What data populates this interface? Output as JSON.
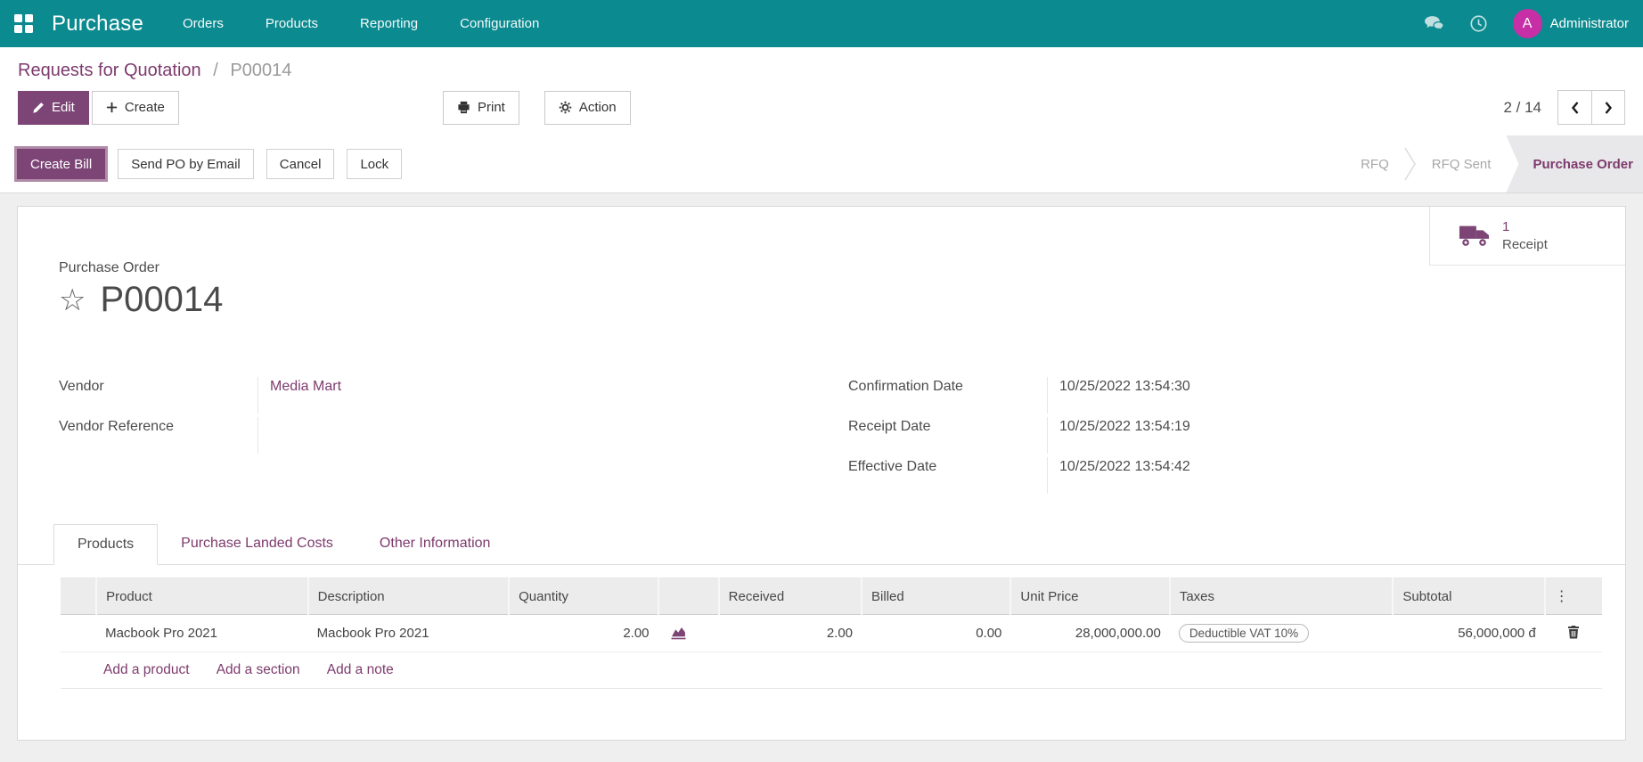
{
  "colors": {
    "navbar_teal": "#0b8a8f",
    "accent_purple": "#7c4576",
    "link_purple": "#7d3a6d",
    "avatar_magenta": "#c62fa5",
    "page_background": "#efefef",
    "state_active_background": "#e8e8ea"
  },
  "navbar": {
    "app_name": "Purchase",
    "menus": [
      {
        "label": "Orders"
      },
      {
        "label": "Products"
      },
      {
        "label": "Reporting"
      },
      {
        "label": "Configuration"
      }
    ],
    "icons": {
      "apps": "grid-icon",
      "messages": "chat-bubbles-icon",
      "activities": "clock-icon"
    },
    "avatar_initial": "A",
    "user_name": "Administrator"
  },
  "breadcrumb": {
    "parent": "Requests for Quotation",
    "separator": "/",
    "current": "P00014"
  },
  "control_panel": {
    "edit_label": "Edit",
    "create_label": "Create",
    "print_label": "Print",
    "action_label": "Action",
    "pager_value": "2 / 14"
  },
  "statusbar": {
    "buttons": [
      {
        "label": "Create Bill",
        "primary": true
      },
      {
        "label": "Send PO by Email",
        "primary": false
      },
      {
        "label": "Cancel",
        "primary": false
      },
      {
        "label": "Lock",
        "primary": false
      }
    ],
    "states": [
      {
        "label": "RFQ",
        "active": false
      },
      {
        "label": "RFQ Sent",
        "active": false
      },
      {
        "label": "Purchase Order",
        "active": true
      }
    ]
  },
  "sheet": {
    "button_box": {
      "count": "1",
      "label": "Receipt",
      "icon": "truck-icon"
    },
    "title_label": "Purchase Order",
    "title": "P00014",
    "fields_left": [
      {
        "label": "Vendor",
        "value": "Media Mart"
      },
      {
        "label": "Vendor Reference",
        "value": ""
      }
    ],
    "fields_right": [
      {
        "label": "Confirmation Date",
        "value": "10/25/2022 13:54:30"
      },
      {
        "label": "Receipt Date",
        "value": "10/25/2022 13:54:19"
      },
      {
        "label": "Effective Date",
        "value": "10/25/2022 13:54:42"
      }
    ],
    "tabs": [
      {
        "label": "Products",
        "active": true
      },
      {
        "label": "Purchase Landed Costs",
        "active": false
      },
      {
        "label": "Other Information",
        "active": false
      }
    ],
    "table": {
      "headers": {
        "product": "Product",
        "description": "Description",
        "quantity": "Quantity",
        "received": "Received",
        "billed": "Billed",
        "unit_price": "Unit Price",
        "taxes": "Taxes",
        "subtotal": "Subtotal"
      },
      "rows": [
        {
          "product": "Macbook Pro 2021",
          "description": "Macbook Pro 2021",
          "quantity": "2.00",
          "received": "2.00",
          "billed": "0.00",
          "unit_price": "28,000,000.00",
          "taxes": "Deductible VAT 10%",
          "subtotal": "56,000,000 đ"
        }
      ],
      "footer_links": [
        {
          "label": "Add a product"
        },
        {
          "label": "Add a section"
        },
        {
          "label": "Add a note"
        }
      ]
    }
  }
}
